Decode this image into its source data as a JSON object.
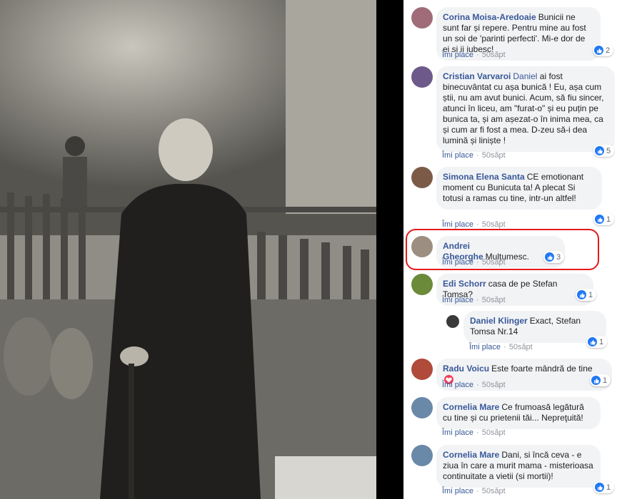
{
  "photo": {
    "description_icon": "old-photo-grandmother"
  },
  "actions": {
    "like": "Îmi place",
    "dot": "·"
  },
  "colors": {
    "link": "#385898",
    "highlight": "#e51a1a",
    "like_blue": "#2078f4"
  },
  "comments": [
    {
      "author": "Corina Moisa-Aredoaie",
      "text": "Bunicii ne sunt far și repere. Pentru mine au fost un soi de 'parinti perfecti'. Mi-e dor de ei si ii iubesc!",
      "time": "50săpt",
      "reactions": "2"
    },
    {
      "author": "Cristian Varvaroi",
      "mention": "Daniel",
      "text": "ai fost binecuvântat cu așa bunică ! Eu, așa cum știi, nu am avut bunici. Acum, să fiu sincer, atunci în liceu, am \"furat-o\" și eu puțin pe bunica ta, și am așezat-o în inima mea, ca și cum ar fi fost a mea. D-zeu să-i dea lumină și liniște !",
      "time": "50săpt",
      "reactions": "5"
    },
    {
      "author": "Simona Elena Santa",
      "text": "CE emotionant moment cu Bunicuta ta! A plecat Si totusi a ramas cu tine, intr-un altfel!",
      "time": "50săpt",
      "reactions": "1"
    },
    {
      "author": "Andrei Gheorghe",
      "text": "Mulțumesc.",
      "time": "50săpt",
      "reactions": "3"
    },
    {
      "author": "Edi Schorr",
      "text": "casa de pe Stefan Tomsa?",
      "time": "50săpt",
      "reactions": "1"
    },
    {
      "author": "Daniel Klinger",
      "text": "Exact, Stefan Tomsa Nr.14",
      "time": "50săpt",
      "reactions": "1"
    },
    {
      "author": "Radu Voicu",
      "text": "Este foarte mândră de tine",
      "time": "50săpt",
      "reactions": "1"
    },
    {
      "author": "Cornelia Mare",
      "text": "Ce frumoasă legătură cu tine și cu prietenii tăi... Nepreţuită!",
      "time": "50săpt",
      "reactions": ""
    },
    {
      "author": "Cornelia Mare",
      "text": "Dani, si încă ceva - e ziua în care a murit mama - misterioasa continuitate a vietii (si mortii)!",
      "time": "50săpt",
      "reactions": "1"
    }
  ]
}
